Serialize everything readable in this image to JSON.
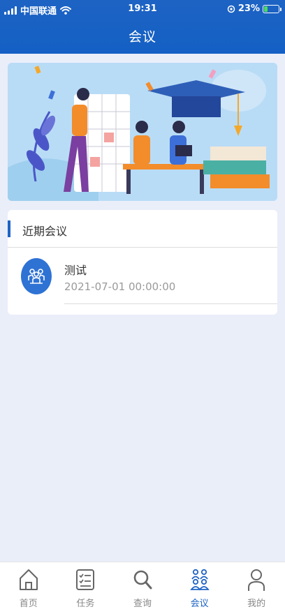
{
  "status_bar": {
    "carrier": "中国联通",
    "time": "19:31",
    "battery_percent": "23%",
    "battery_level": 0.23
  },
  "header": {
    "title": "会议"
  },
  "section": {
    "title": "近期会议"
  },
  "meetings": [
    {
      "name": "测试",
      "time": "2021-07-01 00:00:00",
      "icon": "meeting-people-icon"
    }
  ],
  "tabs": [
    {
      "label": "首页",
      "icon": "home-icon",
      "active": false
    },
    {
      "label": "任务",
      "icon": "task-list-icon",
      "active": false
    },
    {
      "label": "查询",
      "icon": "search-icon",
      "active": false
    },
    {
      "label": "会议",
      "icon": "meeting-icon",
      "active": true
    },
    {
      "label": "我的",
      "icon": "profile-icon",
      "active": false
    }
  ],
  "colors": {
    "primary": "#1d63c4",
    "background": "#eaeef9",
    "inactive_tab": "#888888"
  }
}
